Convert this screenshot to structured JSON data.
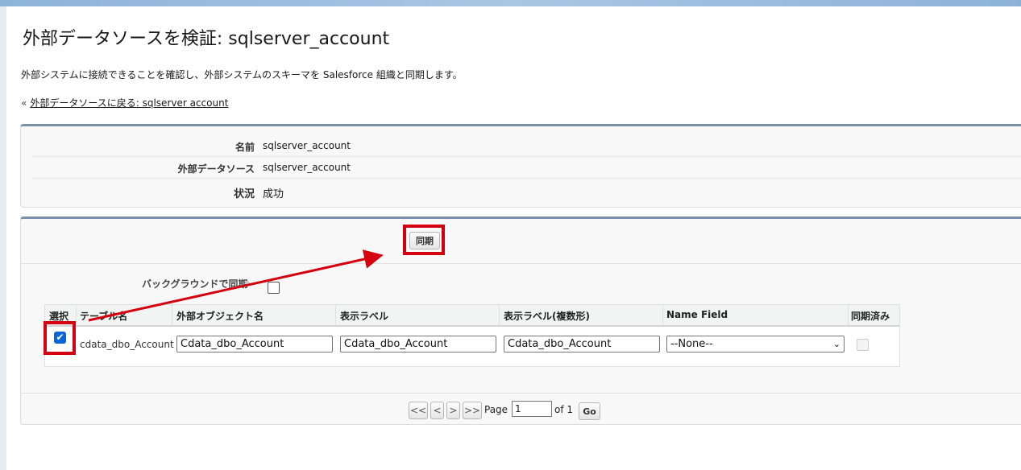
{
  "page": {
    "title": "外部データソースを検証: sqlserver_account",
    "description": "外部システムに接続できることを確認し、外部システムのスキーマを Salesforce 組織と同期します。",
    "back_link_prefix": "«",
    "back_link": "外部データソースに戻る: sqlserver account"
  },
  "info": {
    "name_label": "名前",
    "name_value": "sqlserver_account",
    "source_label": "外部データソース",
    "source_value": "sqlserver_account",
    "status_label": "状況",
    "status_value": "成功"
  },
  "sync": {
    "sync_button": "同期",
    "background_label": "バックグラウンドで同期"
  },
  "table": {
    "headers": [
      "選択",
      "テーブル名",
      "外部オブジェクト名",
      "表示ラベル",
      "表示ラベル(複数形)",
      "Name Field",
      "同期済み"
    ],
    "row": {
      "selected": true,
      "table_name": "cdata_dbo_Account",
      "object_name": "Cdata_dbo_Account",
      "label": "Cdata_dbo_Account",
      "plural_label": "Cdata_dbo_Account",
      "name_field": "--None--",
      "synced": false
    }
  },
  "pager": {
    "first": "<<",
    "prev": "<",
    "next": ">",
    "last": ">>",
    "page_label": "Page",
    "page_value": "1",
    "of_label": "of 1",
    "go_button": "Go"
  },
  "colors": {
    "highlight": "#d4000f",
    "checkbox": "#0a66d6",
    "panel_border": "#7d8fa8"
  }
}
